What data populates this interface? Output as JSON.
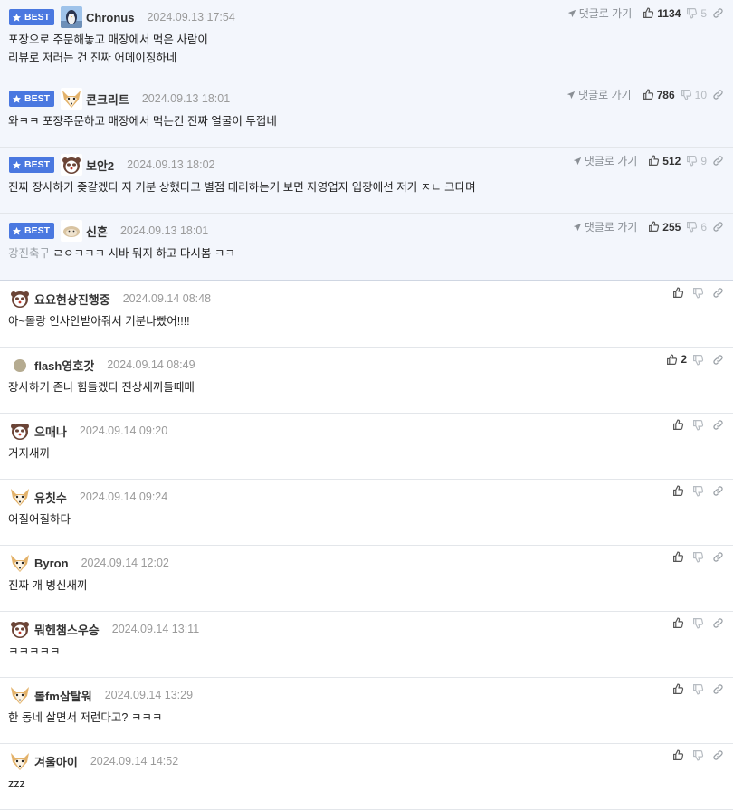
{
  "best_badge": "BEST",
  "reply_link_label": "댓글로 가기",
  "comments": [
    {
      "best": true,
      "avatar": "penguin-avatar",
      "nick": "Chronus",
      "date": "2024.09.13 17:54",
      "lines": [
        "포장으로 주문해놓고 매장에서 먹은 사람이",
        "리뷰로 저러는 건 진짜 어메이징하네"
      ],
      "prefix": "",
      "likes": "1134",
      "dislikes": "5"
    },
    {
      "best": true,
      "avatar": "fox-avatar",
      "nick": "콘크리트",
      "date": "2024.09.13 18:01",
      "lines": [
        "와ㅋㅋ 포장주문하고 매장에서 먹는건 진짜 얼굴이 두껍네"
      ],
      "prefix": "",
      "likes": "786",
      "dislikes": "10"
    },
    {
      "best": true,
      "avatar": "ferret-avatar",
      "nick": "보안2",
      "date": "2024.09.13 18:02",
      "lines": [
        "진짜 장사하기 좆같겠다 지 기분 상했다고 별점 테러하는거 보면 자영업자 입장에선 저거 ㅈㄴ 크다며"
      ],
      "prefix": "",
      "likes": "512",
      "dislikes": "9"
    },
    {
      "best": true,
      "avatar": "dog-avatar",
      "nick": "신혼",
      "date": "2024.09.13 18:01",
      "lines": [
        "ㄹㅇㅋㅋㅋ 시바 뭐지 하고 다시봄 ㅋㅋ"
      ],
      "prefix": "강진축구",
      "likes": "255",
      "dislikes": "6"
    },
    {
      "best": false,
      "avatar": "ferret-avatar",
      "nick": "요요현상진행중",
      "date": "2024.09.14 08:48",
      "lines": [
        "아~몰랑 인사안받아줘서 기분나빴어!!!!"
      ],
      "prefix": "",
      "likes": "",
      "dislikes": ""
    },
    {
      "best": false,
      "avatar": "dot-avatar",
      "nick": "flash영호갓",
      "date": "2024.09.14 08:49",
      "lines": [
        "장사하기 존나 힘들겠다 진상새끼들때매"
      ],
      "prefix": "",
      "likes": "2",
      "dislikes": ""
    },
    {
      "best": false,
      "avatar": "ferret-avatar",
      "nick": "으매나",
      "date": "2024.09.14 09:20",
      "lines": [
        "거지새끼"
      ],
      "prefix": "",
      "likes": "",
      "dislikes": ""
    },
    {
      "best": false,
      "avatar": "fox-avatar",
      "nick": "유칫수",
      "date": "2024.09.14 09:24",
      "lines": [
        "어질어질하다"
      ],
      "prefix": "",
      "likes": "",
      "dislikes": ""
    },
    {
      "best": false,
      "avatar": "fox-avatar",
      "nick": "Byron",
      "date": "2024.09.14 12:02",
      "lines": [
        "진짜 개 병신새끼"
      ],
      "prefix": "",
      "likes": "",
      "dislikes": ""
    },
    {
      "best": false,
      "avatar": "ferret-avatar",
      "nick": "뭐헨챔스우승",
      "date": "2024.09.14 13:11",
      "lines": [
        "ㅋㅋㅋㅋㅋ"
      ],
      "prefix": "",
      "likes": "",
      "dislikes": ""
    },
    {
      "best": false,
      "avatar": "fox-avatar",
      "nick": "롤fm삼탈워",
      "date": "2024.09.14 13:29",
      "lines": [
        "한 동네 살면서 저런다고? ㅋㅋㅋ"
      ],
      "prefix": "",
      "likes": "",
      "dislikes": ""
    },
    {
      "best": false,
      "avatar": "fox-avatar",
      "nick": "겨울아이",
      "date": "2024.09.14 14:52",
      "lines": [
        "zzz"
      ],
      "prefix": "",
      "likes": "",
      "dislikes": ""
    }
  ]
}
